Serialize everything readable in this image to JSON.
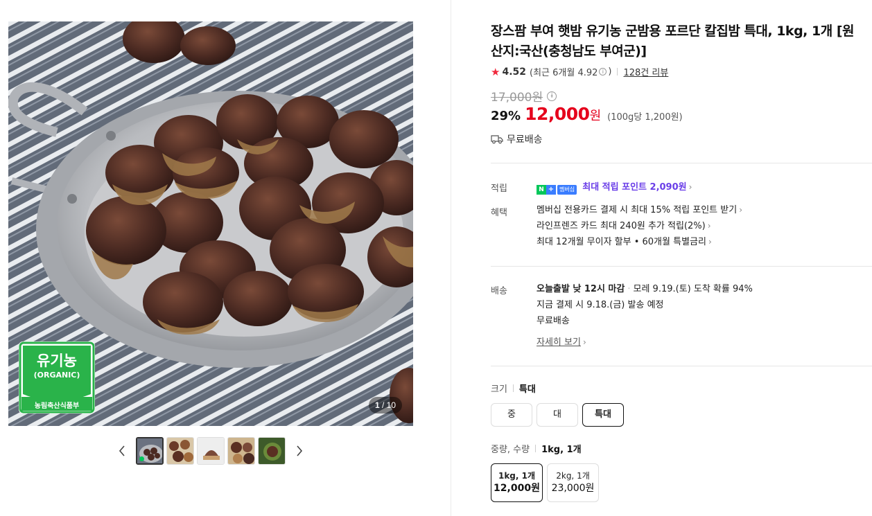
{
  "gallery": {
    "counter_current": "1",
    "counter_total": "/ 10",
    "badge_main": "유기농",
    "badge_sub": "(ORGANIC)",
    "badge_footer": "농림축산식품부",
    "thumbnails": [
      "thumb-1",
      "thumb-2",
      "thumb-3",
      "thumb-4",
      "thumb-5"
    ],
    "prev_icon": "chevron-left-icon",
    "next_icon": "chevron-right-icon"
  },
  "product": {
    "title": "장스팜 부여 햇밤 유기농 군밤용 포르단 칼집밤 특대, 1kg, 1개 [원산지:국산(충청남도 부여군)]",
    "rating": "4.52",
    "rating_recent": "(최근 6개월 4.92",
    "rating_recent_close": ")",
    "review_count": "128건 리뷰",
    "original_price": "17,000원",
    "discount": "29%",
    "price": "12,000",
    "price_unit": "원",
    "unit_price": "(100g당 1,200원)",
    "free_shipping": "무료배송"
  },
  "points": {
    "label": "적립",
    "badge_n": "N",
    "badge_plus": "+",
    "badge_membership": "멤버십",
    "text": "최대 적립 포인트 2,090원"
  },
  "benefits": {
    "label": "혜택",
    "items": [
      "멤버십 전용카드 결제 시 최대 15% 적립 포인트 받기",
      "라인프렌즈 카드 최대 240원 추가 적립(2%)",
      "최대 12개월 무이자 할부 • 60개월 특별금리"
    ]
  },
  "shipping": {
    "label": "배송",
    "deadline": "오늘출발 낮 12시 마감",
    "arrival": "모레 9.19.(토) 도착 확률 94%",
    "dispatch": "지금 결제 시 9.18.(금) 발송 예정",
    "fee": "무료배송",
    "more": "자세히 보기"
  },
  "options": {
    "size_label": "크기",
    "size_selected": "특대",
    "sizes": [
      "중",
      "대",
      "특대"
    ],
    "qty_label": "중량, 수량",
    "qty_selected": "1kg, 1개",
    "quantities": [
      {
        "name": "1kg, 1개",
        "price": "12,000원"
      },
      {
        "name": "2kg, 1개",
        "price": "23,000원"
      }
    ]
  },
  "colors": {
    "price_red": "#e5001c",
    "point_purple": "#6a3ee8",
    "naver_green": "#03c75a",
    "star_red": "#f0283c"
  }
}
